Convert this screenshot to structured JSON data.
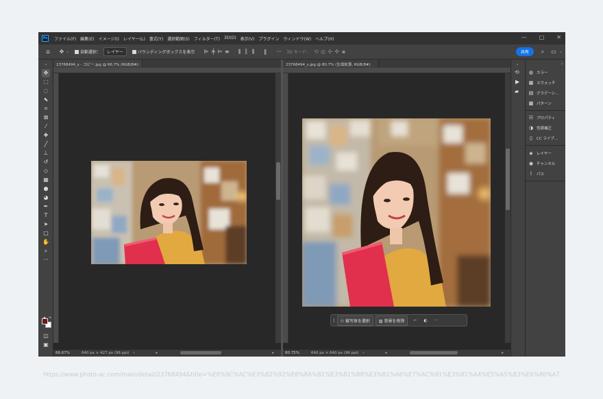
{
  "app": {
    "logo": "Ps"
  },
  "menu": [
    "ファイル(F)",
    "編集(E)",
    "イメージ(I)",
    "レイヤー(L)",
    "書式(Y)",
    "選択範囲(S)",
    "フィルター(T)",
    "3D(D)",
    "表示(V)",
    "プラグイン",
    "ウィンドウ(W)",
    "ヘルプ(H)"
  ],
  "window_controls": {
    "minimize": "—",
    "maximize": "□",
    "close": "✕"
  },
  "options": {
    "auto_select_label": "自動選択：",
    "auto_select_value": "レイヤー",
    "transform_label": "バウンディングボックスを表示",
    "mode_3d": "3D モード：",
    "share": "共有"
  },
  "docs": [
    {
      "tab": "23768494_s - コピー.jpg @ 66.7% (RGB/8#)",
      "zoom": "66.67%",
      "size": "640 px × 427 px (96 ppi)"
    },
    {
      "tab": "23768494_s.jpg @ 80.7% (生成拡張, RGB/8#)",
      "zoom": "80.75%",
      "size": "640 px × 640 px (96 ppi)"
    }
  ],
  "context_bar": {
    "select_subject": "被写体を選択",
    "remove_bg": "背景を削除"
  },
  "panels": {
    "group1": [
      "カラー",
      "スウォッチ",
      "グラデーシ...",
      "パターン"
    ],
    "group2": [
      "プロパティ",
      "色調補正",
      "CC ライブ..."
    ],
    "group3": [
      "レイヤー",
      "チャンネル",
      "パス"
    ]
  },
  "colors": {
    "accent": "#1473e6",
    "foreground": "#6b1a12",
    "background": "#ffffff"
  },
  "watermark": "https://www.photo-ac.com/main/detail/23768494&title=%E6%9C%AC%E3%82%92%E6%8A%B1%E3%81%88%E3%81%A6%E7%AC%91%E3%81%A4%E5%A5%B3%E6%80%A7"
}
